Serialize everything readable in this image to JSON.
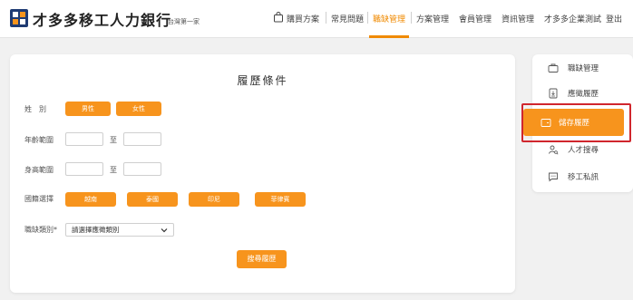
{
  "header": {
    "brand": "才多多移工人力銀行",
    "brand_sub": "台灣第一家",
    "nav": {
      "buy": "購買方案",
      "faq": "常見問題",
      "jobs": "職缺管理",
      "plans": "方案管理",
      "members": "會員管理",
      "info": "資訊管理",
      "user": "才多多企業測試",
      "logout": "登出"
    }
  },
  "main": {
    "title": "履歷條件",
    "gender": {
      "label": "姓　別",
      "options": [
        "男性",
        "女性"
      ]
    },
    "age": {
      "label": "年齡範圍",
      "to": "至"
    },
    "height": {
      "label": "身高範圍",
      "to": "至"
    },
    "nationality": {
      "label": "國籍選擇",
      "options": [
        "越南",
        "泰國",
        "印尼",
        "菲律賓"
      ]
    },
    "job_type": {
      "label": "職缺類別*",
      "placeholder": "請選擇應徵類別"
    },
    "search_button": "搜尋履歷"
  },
  "side_menu": {
    "items": [
      {
        "label": "職缺管理",
        "icon": "briefcase-icon"
      },
      {
        "label": "應徵履歷",
        "icon": "document-download-icon"
      },
      {
        "label": "儲存履歷",
        "icon": "folder-save-icon",
        "active": true
      },
      {
        "label": "人才搜尋",
        "icon": "user-search-icon"
      },
      {
        "label": "移工私訊",
        "icon": "chat-icon"
      }
    ]
  },
  "colors": {
    "accent": "#f7941d",
    "active_nav": "#f08a00",
    "highlight": "#d0262d"
  }
}
